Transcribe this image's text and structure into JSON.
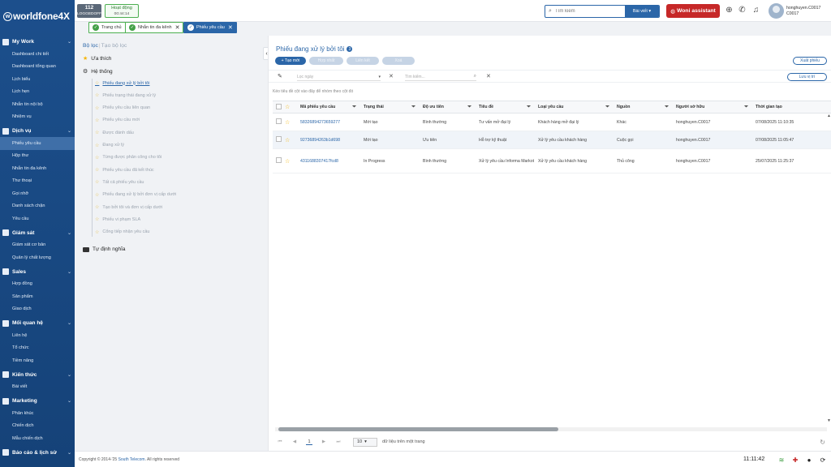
{
  "app": {
    "logo": "worldfone4X",
    "logo_letter": "w"
  },
  "header": {
    "extension": "112",
    "extension_status": "LOGGEDOFF",
    "activity_label": "Hoạt động",
    "activity_timer": "00:44:14",
    "search_placeholder": "Tìm kiếm",
    "search_scope": "Bài viết",
    "assistant_label": "Woni assistant",
    "username": "honghuyen.C0017",
    "user_code": "C0017"
  },
  "tabs": [
    {
      "label": "Trang chủ"
    },
    {
      "label": "Nhắn tin đa kênh"
    },
    {
      "label": "Phiếu yêu cầu"
    }
  ],
  "sidebar": {
    "groups": [
      {
        "label": "My Work",
        "items": [
          "Dashboard chi tiết",
          "Dashboard tổng quan",
          "Lịch biểu",
          "Lịch hẹn",
          "Nhắn tin nội bộ",
          "Nhiệm vụ"
        ]
      },
      {
        "label": "Dịch vụ",
        "items": [
          "Phiếu yêu cầu",
          "Hộp thư",
          "Nhắn tin đa kênh",
          "Thư thoại",
          "Gọi nhỡ",
          "Danh sách chặn",
          "Yêu cầu"
        ]
      },
      {
        "label": "Giám sát",
        "items": [
          "Giám sát cơ bản",
          "Quản lý chất lượng"
        ]
      },
      {
        "label": "Sales",
        "items": [
          "Hợp đồng",
          "Sản phẩm",
          "Giao dịch"
        ]
      },
      {
        "label": "Mối quan hệ",
        "items": [
          "Liên hệ",
          "Tổ chức",
          "Tiềm năng"
        ]
      },
      {
        "label": "Kiến thức",
        "items": [
          "Bài viết"
        ]
      },
      {
        "label": "Marketing",
        "items": [
          "Phân khúc",
          "Chiến dịch",
          "Mẫu chiến dịch"
        ]
      },
      {
        "label": "Báo cáo & lịch sử",
        "items": []
      }
    ],
    "active_item": "Phiếu yêu cầu"
  },
  "filter_panel": {
    "tab_filter": "Bộ lọc",
    "tab_create": "Tạo bộ lọc",
    "favorites": "Ưa thích",
    "system": "Hệ thống",
    "system_items": [
      "Phiếu đang xử lý bởi tôi",
      "Phiếu trạng thái đang xử lý",
      "Phiếu yêu cầu liên quan",
      "Phiếu yêu cầu mới",
      "Được đánh dấu",
      "Đang xử lý",
      "Từng được phân công cho tôi",
      "Phiếu yêu cầu đã kết thúc",
      "Tất cả phiếu yêu cầu",
      "Phiếu đang xử lý bởi đơn vị cấp dưới",
      "Tạo bởi tôi và đơn vị cấp dưới",
      "Phiếu vi phạm SLA",
      "Cổng tiếp nhận yêu cầu"
    ],
    "custom": "Tự định nghĩa"
  },
  "main": {
    "title": "Phiếu đang xử lý bởi tôi",
    "count": "3",
    "buttons": {
      "create": "+ Tạo mới",
      "merge": "Hợp nhất",
      "link": "Liên kết",
      "delete": "Xoá",
      "export": "Xuất phiếu",
      "save_position": "Lưu vị trí"
    },
    "date_placeholder": "Lọc ngày",
    "search_placeholder": "Tìm kiếm...",
    "group_hint": "Kéo tiêu đề cột vào đây để nhóm theo cột đó",
    "columns": [
      "Mã phiếu yêu cầu",
      "Trạng thái",
      "Độ ưu tiên",
      "Tiêu đề",
      "Loại yêu cầu",
      "Nguồn",
      "Người sở hữu",
      "Thời gian tạo"
    ],
    "rows": [
      {
        "id": "58326894273659277",
        "status": "Mới tạo",
        "priority": "Bình thường",
        "title": "Tư vấn mở đại lý",
        "type": "Khách hàng mở đại lý",
        "source": "Khác",
        "owner": "honghuyen.C0017",
        "created": "07/08/2025 11:10:35"
      },
      {
        "id": "92736894263b1d698",
        "status": "Mới tạo",
        "priority": "Ưu tiên",
        "title": "Hỗ trợ kỹ thuật",
        "type": "Xử lý yêu cầu khách hàng",
        "source": "Cuộc gọi",
        "owner": "honghuyen.C0017",
        "created": "07/08/2025 11:05:47"
      },
      {
        "id": "4311688307417fcd8",
        "status": "In Progress",
        "priority": "Bình thường",
        "title": "Xử lý yêu cầu Informa Markot",
        "type": "Xử lý yêu cầu khách hàng",
        "source": "Thủ công",
        "owner": "honghuyen.C0017",
        "created": "25/07/2025 11:25:37"
      }
    ],
    "pager": {
      "first": "⏮",
      "prev": "◀",
      "current": "1",
      "next": "▶",
      "last": "⏭",
      "page_size": "10",
      "page_size_label": "dữ liệu trên một trang"
    }
  },
  "footer": {
    "copyright_prefix": "Copyright © 2014-'25",
    "brand": "South Telecom",
    "copyright_suffix": ". All rights reserved",
    "clock": "11:11:42"
  },
  "colors": {
    "primary": "#2b66a8",
    "sidebar": "#1c4f8c",
    "assistant": "#c62828",
    "success": "#43a047",
    "star": "#f5b400"
  }
}
